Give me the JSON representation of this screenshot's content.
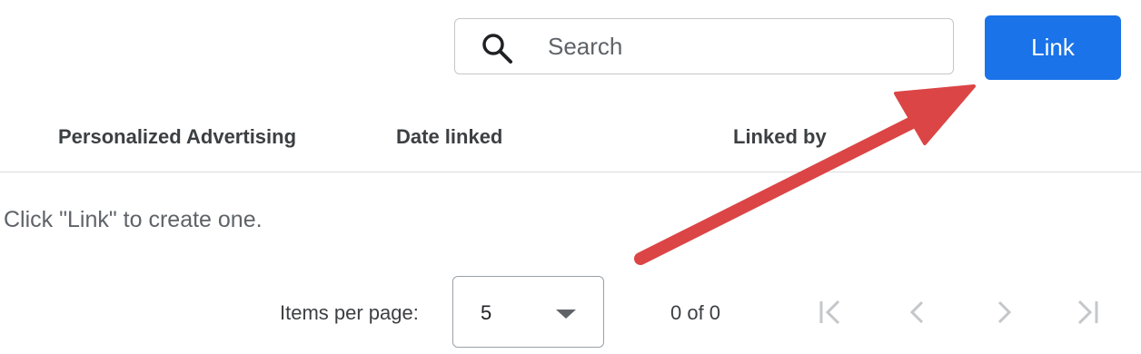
{
  "toolbar": {
    "search_placeholder": "Search",
    "link_label": "Link"
  },
  "table": {
    "columns": [
      "Personalized Advertising",
      "Date linked",
      "Linked by"
    ],
    "empty_message": "Click \"Link\" to create one."
  },
  "pagination": {
    "items_per_page_label": "Items per page:",
    "page_size": "5",
    "range": "0 of 0"
  },
  "icons": {
    "search": "search-icon",
    "dropdown": "chevron-down-icon",
    "first_page": "first-page-icon",
    "previous_page": "chevron-left-icon",
    "next_page": "chevron-right-icon",
    "last_page": "last-page-icon",
    "annotation": "arrow-icon"
  },
  "colors": {
    "primary_button": "#1a73e8",
    "annotation_arrow": "#db4545",
    "divider": "#dadce0"
  }
}
